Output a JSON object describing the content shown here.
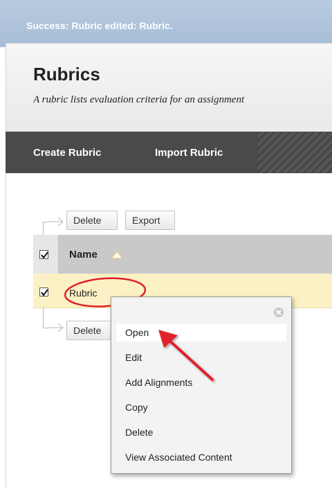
{
  "success": {
    "message": "Success: Rubric edited: Rubric."
  },
  "page": {
    "title": "Rubrics",
    "description": "A rubric lists evaluation criteria for an assignment"
  },
  "action_bar": {
    "create_label": "Create Rubric",
    "import_label": "Import Rubric"
  },
  "table": {
    "top_buttons": {
      "delete": "Delete",
      "export": "Export"
    },
    "bottom_buttons": {
      "delete": "Delete"
    },
    "column_name": "Name",
    "rows": [
      {
        "name": "Rubric",
        "checked": true
      }
    ],
    "header_checked": true
  },
  "context_menu": {
    "items": [
      "Open",
      "Edit",
      "Add Alignments",
      "Copy",
      "Delete",
      "View Associated Content"
    ],
    "active": "Open"
  },
  "colors": {
    "success_bar": "#a6bdd6",
    "action_bar": "#4a4a4a",
    "row_highlight": "#fbf1c5",
    "annotation_red": "#e0202a"
  },
  "icons": {
    "sort": "sort-ascending-icon",
    "close": "close-circle-icon",
    "check": "checkmark-icon"
  }
}
